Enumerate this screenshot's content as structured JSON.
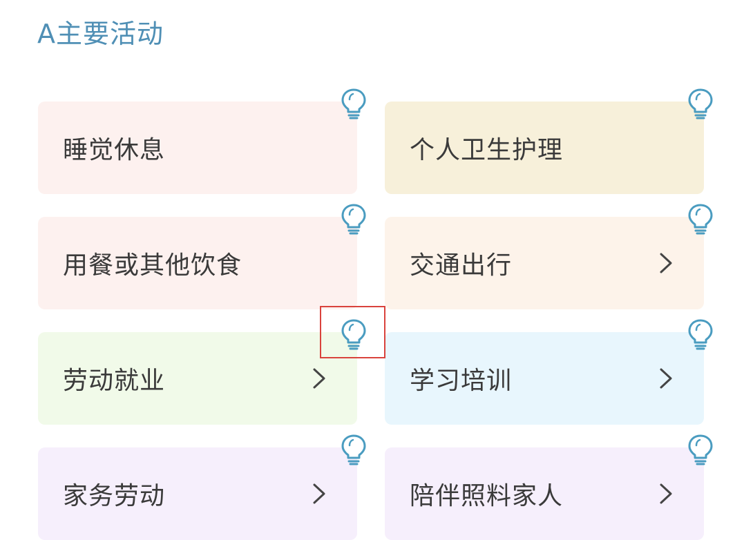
{
  "section": {
    "title": "A主要活动"
  },
  "colors": {
    "title": "#4f8fb5",
    "bulb": "#4a9cc0",
    "highlight": "#d9423c"
  },
  "cards": [
    {
      "label": "睡觉休息",
      "bg": "#fdf1ef",
      "chevron": false
    },
    {
      "label": "个人卫生护理",
      "bg": "#f7f0da",
      "chevron": false
    },
    {
      "label": "用餐或其他饮食",
      "bg": "#fdf1ef",
      "chevron": false
    },
    {
      "label": "交通出行",
      "bg": "#fdf3ea",
      "chevron": true
    },
    {
      "label": "劳动就业",
      "bg": "#f1fae9",
      "chevron": true
    },
    {
      "label": "学习培训",
      "bg": "#e8f6fd",
      "chevron": true
    },
    {
      "label": "家务劳动",
      "bg": "#f6effc",
      "chevron": true
    },
    {
      "label": "陪伴照料家人",
      "bg": "#f6effc",
      "chevron": true
    }
  ],
  "icons": {
    "tip": "lightbulb-icon",
    "arrow": "chevron-right-icon"
  }
}
